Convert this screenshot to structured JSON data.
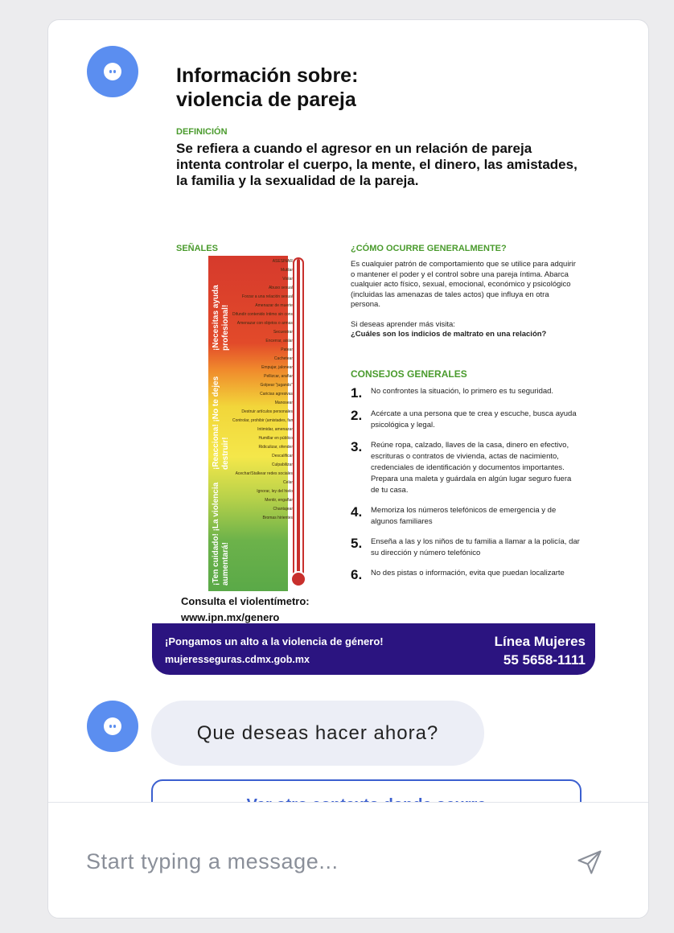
{
  "flyer": {
    "title_line1": "Información sobre:",
    "title_line2": "violencia de pareja",
    "definition_heading": "DEFINICIÓN",
    "definition_text": "Se refiera a cuando el agresor en un relación de pareja intenta controlar el cuerpo, la mente, el dinero, las amistades, la familia y la sexualidad de la pareja.",
    "signals_heading": "SEÑALES",
    "meter_zones": [
      "¡Necesitas ayuda profesional!",
      "¡Reacciona! ¡No te dejes destruir!",
      "¡Ten cuidado! ¡La violencia aumentará!"
    ],
    "meter_levels": [
      "ASESINAR",
      "Mutilar",
      "Violar",
      "Abuso sexual",
      "Forzar a una relación sexual",
      "Amenazar de muerte",
      "Difundir contenido íntimo sin consentimiento por medios digitales",
      "Amenazar con objetos o armas",
      "Secuestrar",
      "Encerrar, aislar",
      "Patear",
      "Cachetear",
      "Empujar, jalonear",
      "Pellizcar, arañar",
      "Golpear \"jugando\"",
      "Caricias agresivas",
      "Manosear",
      "Destruir artículos personales",
      "Controlar, prohibir (amistades, familiares, dinero, lugares, apariencia, actividades, celular, mails y redes sociales)",
      "Intimidar, amenazar",
      "Humillar en público",
      "Ridiculizar, ofender",
      "Descalificar",
      "Culpabilizar",
      "Acechar/Stalkear redes sociales",
      "Celar",
      "Ignorar, ley del hielo",
      "Mentir, engañar",
      "Chantajear",
      "Bromas hirientes"
    ],
    "consulta_line1": "Consulta el violentímetro:",
    "consulta_line2": "www.ipn.mx/genero",
    "como_heading": "¿CÓMO OCURRE GENERALMENTE?",
    "como_text": "Es cualquier patrón de comportamiento que se utilice para adquirir o mantener el poder y el control sobre una pareja íntima. Abarca cualquier acto físico, sexual, emocional, económico y psicológico (incluidas las amenazas de tales actos) que influya en otra persona.",
    "como_more": "Si deseas aprender más visita:",
    "como_link": "¿Cuáles son los indicios de maltrato en una relación?",
    "consejos_heading": "CONSEJOS GENERALES",
    "tips": [
      {
        "num": "1.",
        "text": "No confrontes la situación, lo primero es tu seguridad."
      },
      {
        "num": "2.",
        "text": "Acércate a una persona que te crea y escuche, busca ayuda psicológica y legal."
      },
      {
        "num": "3.",
        "text": "Reúne ropa, calzado, llaves de la casa, dinero en efectivo, escrituras o contratos de vivienda, actas de nacimiento, credenciales de identificación y documentos importantes. Prepara una maleta y guárdala en algún lugar seguro fuera de tu casa."
      },
      {
        "num": "4.",
        "text": "Memoriza los números telefónicos de emergencia y de algunos familiares"
      },
      {
        "num": "5.",
        "text": "Enseña a las y los niños de tu familia a llamar a la policía, dar su dirección y número telefónico"
      },
      {
        "num": "6.",
        "text": "No des pistas o información, evita que puedan localizarte"
      }
    ],
    "banner_slogan": "¡Pongamos un alto a la violencia de género!",
    "banner_url": "mujeresseguras.cdmx.gob.mx",
    "banner_line_label": "Línea Mujeres",
    "banner_phone": "55 5658-1111"
  },
  "bot_message": "Que deseas hacer ahora?",
  "option_button": "Ver otro contexto donde ocurre",
  "composer": {
    "placeholder": "Start typing a message...",
    "send_icon": "paper-plane-icon"
  },
  "colors": {
    "avatar": "#5b8ef0",
    "accent_green": "#4a9b2d",
    "banner": "#2b1480",
    "option_border": "#3b5fcf"
  }
}
